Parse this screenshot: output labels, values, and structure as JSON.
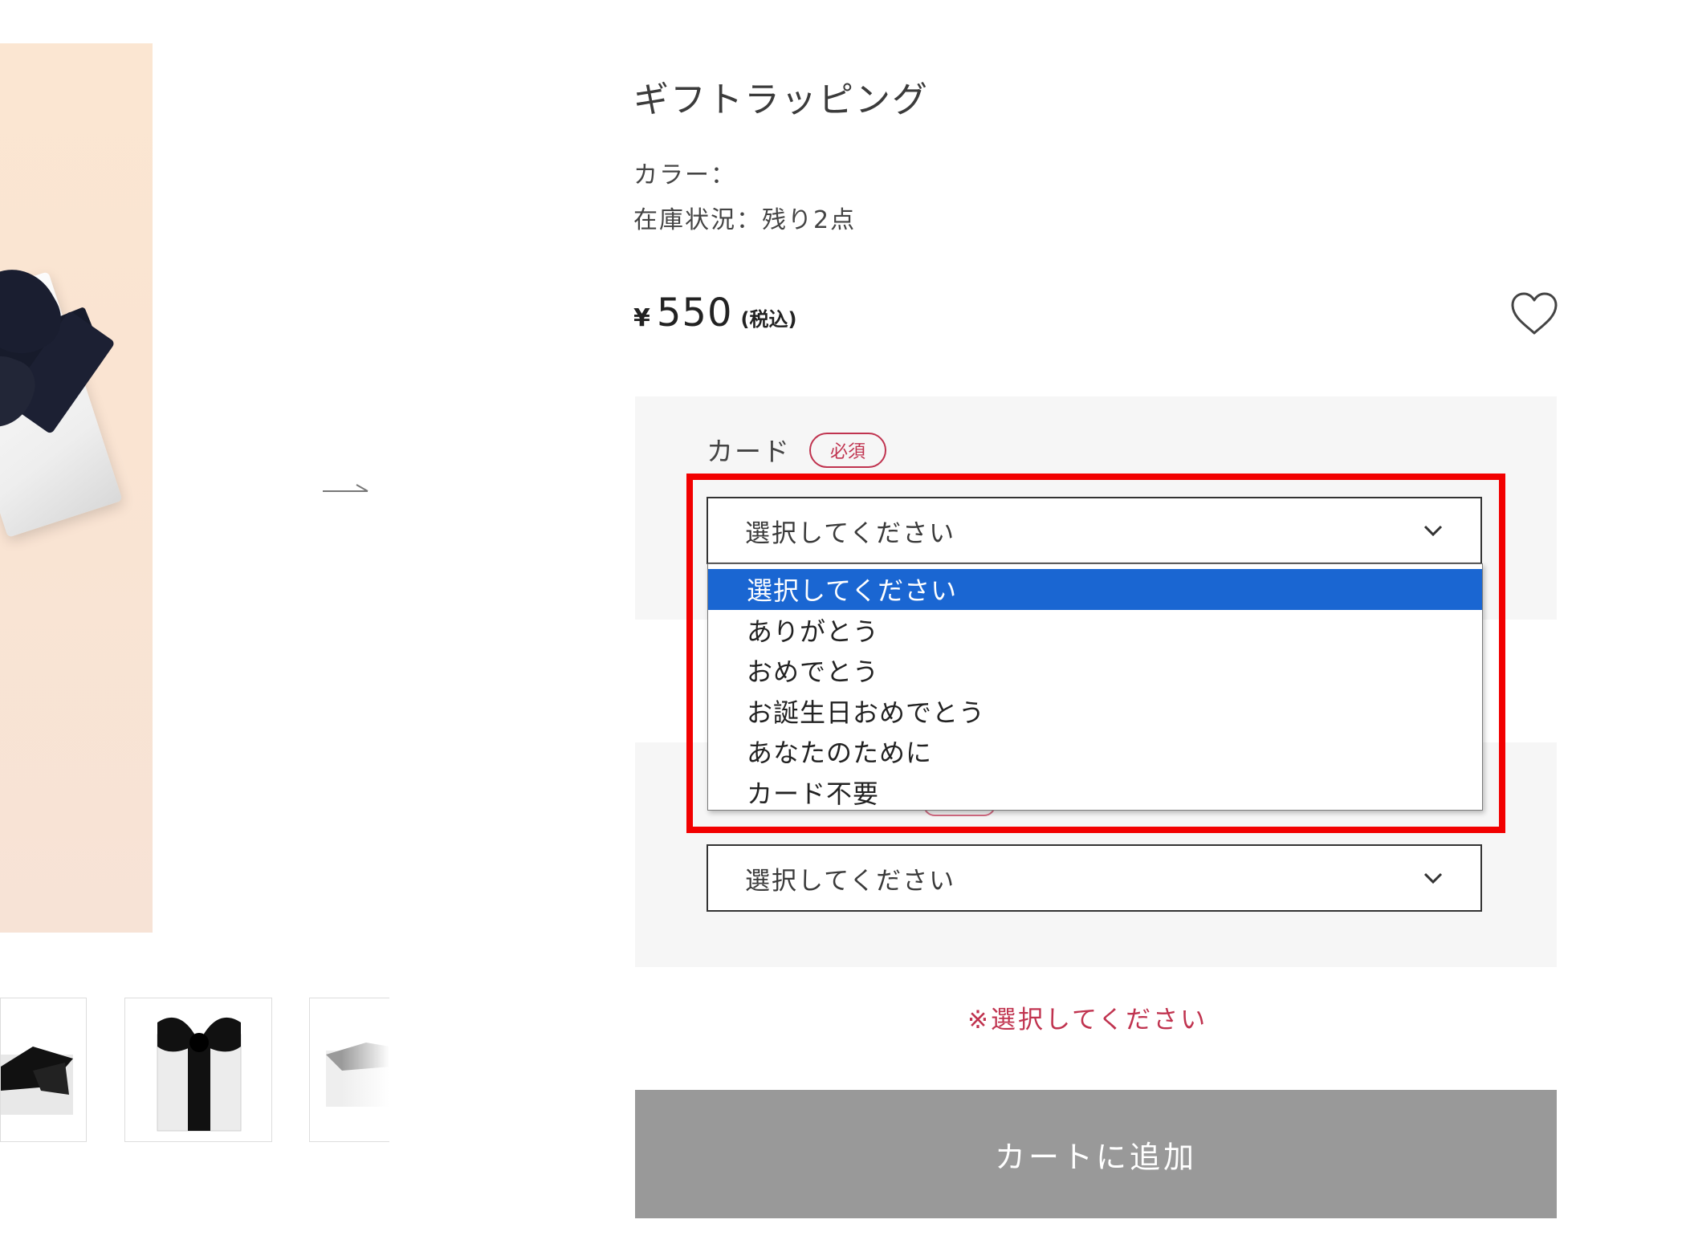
{
  "product": {
    "title": "ギフトラッピング",
    "color_label": "カラー：",
    "stock_text": "在庫状況：残り2点",
    "price_symbol": "¥",
    "price_amount": "550",
    "price_tax_note": "(税込)"
  },
  "card_option": {
    "label": "カード",
    "required_badge": "必須",
    "selected_value": "選択してください",
    "options": [
      "選択してください",
      "ありがとう",
      "おめでとう",
      "お誕生日おめでとう",
      "あなたのために",
      "カード不要"
    ]
  },
  "second_option": {
    "selected_value": "選択してください"
  },
  "warning_text": "※選択してください",
  "cart_button_label": "カートに追加",
  "icons": {
    "favorite": "heart-outline-icon",
    "next": "arrow-right-icon",
    "select": "chevron-down-icon"
  },
  "colors": {
    "accent_required": "#c0334f",
    "dropdown_selected": "#1a66d2",
    "highlight_box": "#f20000",
    "cart_button": "#999999"
  }
}
